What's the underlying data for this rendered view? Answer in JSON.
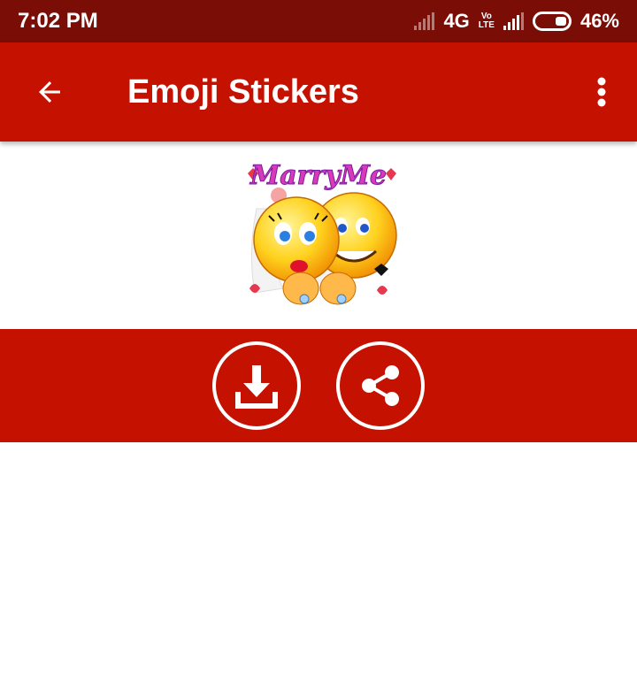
{
  "status_bar": {
    "time": "7:02 PM",
    "network": "4G",
    "volte_top": "Vo",
    "volte_bottom": "LTE",
    "battery": "46%"
  },
  "app_bar": {
    "title": "Emoji Stickers",
    "back_icon": "arrow-back-icon",
    "menu_icon": "more-vert-icon"
  },
  "sticker": {
    "banner_text": "MarryMe"
  },
  "actions": {
    "download_icon": "download-icon",
    "share_icon": "share-icon"
  },
  "colors": {
    "status_bar": "#7a0d06",
    "primary": "#c51100",
    "background": "#ffffff"
  }
}
